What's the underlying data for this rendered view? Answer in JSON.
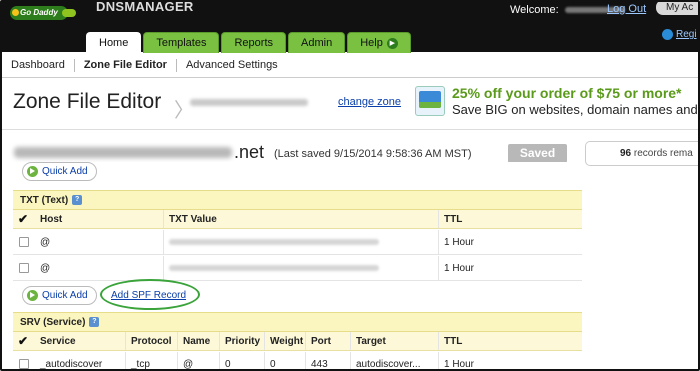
{
  "topbar": {
    "logo_text": "Go Daddy",
    "app_name": "DNSMANAGER",
    "welcome_label": "Welcome:",
    "logout_label": "Log Out",
    "my_account_label": "My Ac",
    "register_label": "Regi"
  },
  "tabs": [
    {
      "label": "Home",
      "active": true
    },
    {
      "label": "Templates",
      "active": false
    },
    {
      "label": "Reports",
      "active": false
    },
    {
      "label": "Admin",
      "active": false
    },
    {
      "label": "Help",
      "active": false
    }
  ],
  "subnav": {
    "items": [
      "Dashboard",
      "Zone File Editor",
      "Advanced Settings"
    ],
    "active_index": 1
  },
  "header": {
    "title": "Zone File Editor",
    "change_zone_label": "change zone"
  },
  "promo": {
    "line1": "25% off your order of $75 or more*",
    "line2": "Save BIG on websites, domain names and"
  },
  "domain": {
    "tld": ".net",
    "last_saved": "(Last saved 9/15/2014 9:58:36 AM MST)",
    "saved_button": "Saved",
    "records_count": "96",
    "records_label": "records rema"
  },
  "quick_add_label": "Quick Add",
  "txt_section": {
    "title": "TXT (Text)",
    "columns": [
      "Host",
      "TXT Value",
      "TTL"
    ],
    "rows": [
      {
        "host": "@",
        "ttl": "1 Hour"
      },
      {
        "host": "@",
        "ttl": "1 Hour"
      }
    ],
    "add_spf_label": "Add SPF Record"
  },
  "srv_section": {
    "title": "SRV (Service)",
    "columns": [
      "Service",
      "Protocol",
      "Name",
      "Priority",
      "Weight",
      "Port",
      "Target",
      "TTL"
    ],
    "rows": [
      {
        "service": "_autodiscover",
        "protocol": "_tcp",
        "name": "@",
        "priority": "0",
        "weight": "0",
        "port": "443",
        "target": "autodiscover...",
        "ttl": "1 Hour"
      }
    ]
  },
  "colors": {
    "topbar": "#111111",
    "tab_green": "#7ac142",
    "section_yellow": "#fbf5bf",
    "link_blue": "#0a3ea8",
    "highlight_ring": "#3aa33a"
  }
}
